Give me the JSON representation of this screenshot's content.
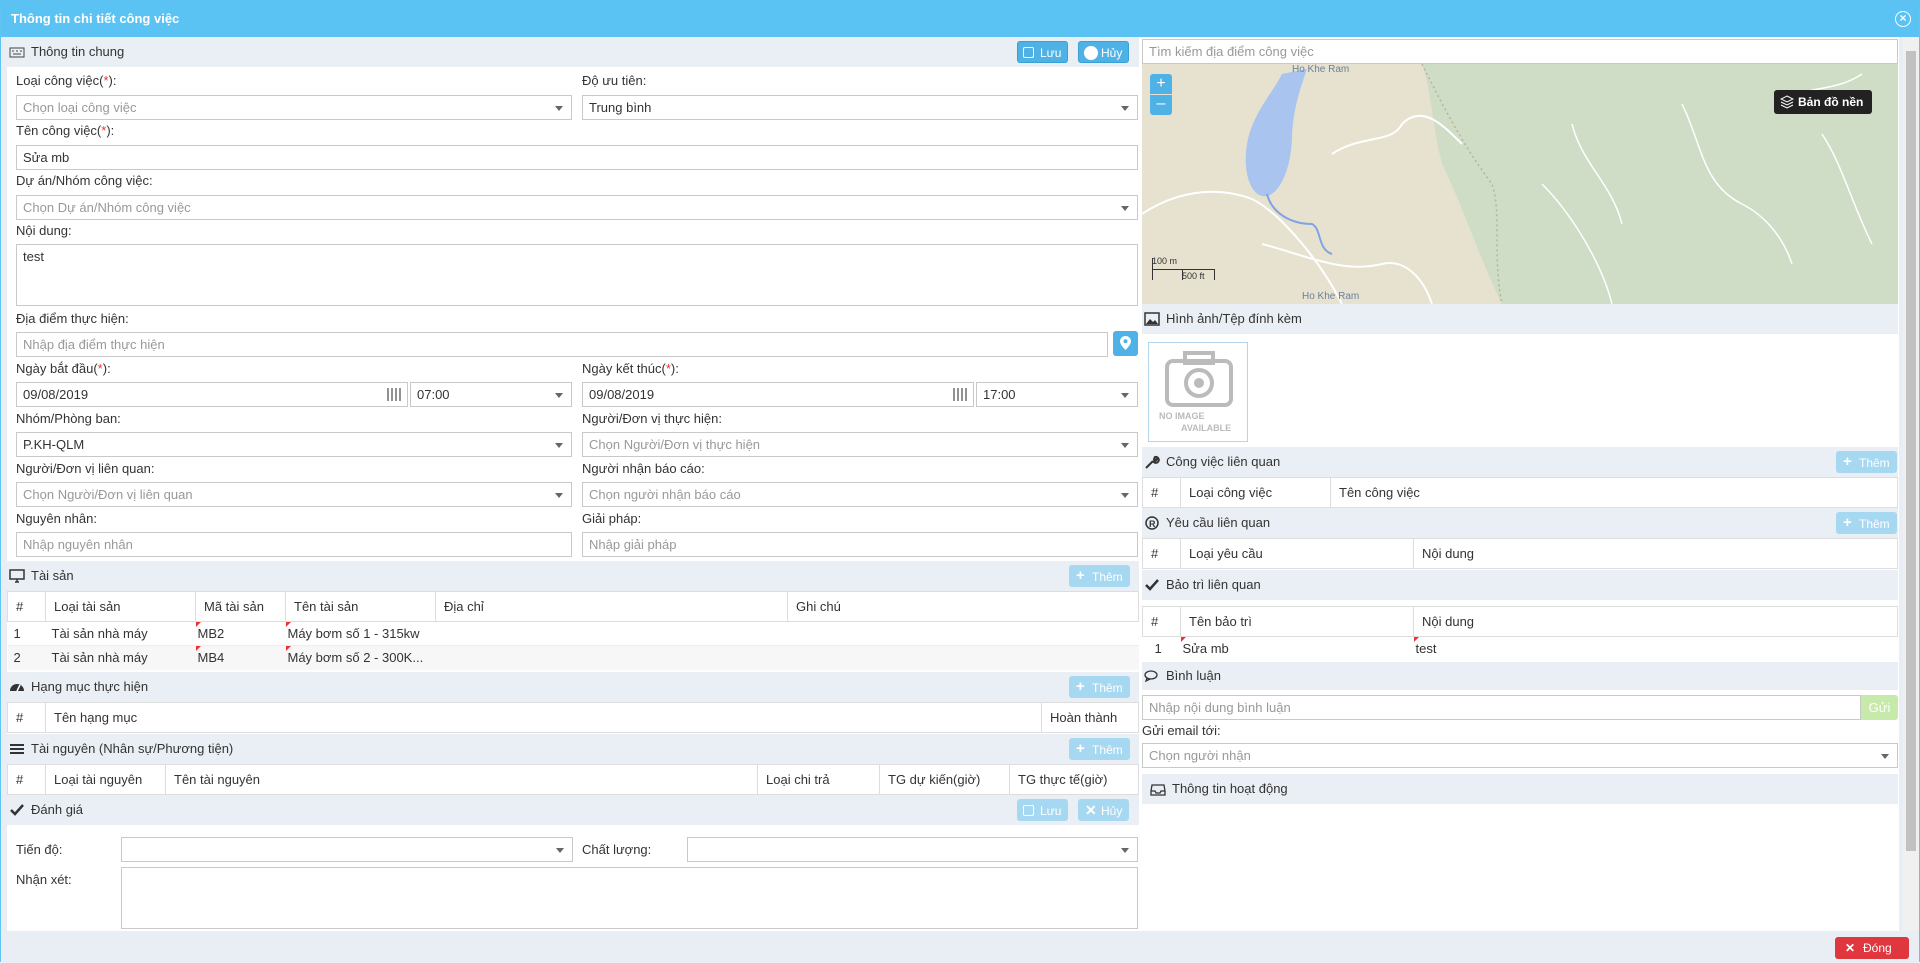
{
  "dialog": {
    "title": "Thông tin chi tiết công việc",
    "close_label": "Đóng"
  },
  "general": {
    "title": "Thông tin chung",
    "save": "Lưu",
    "cancel": "Hủy",
    "job_type_label": "Loại công việc(",
    "job_type_req": "*",
    "job_type_end": "):",
    "job_type_placeholder": "Chọn loại công việc",
    "priority_label": "Độ ưu tiên:",
    "priority_value": "Trung bình",
    "job_name_label": "Tên công việc(",
    "job_name_value": "Sửa mb",
    "project_label": "Dự án/Nhóm công việc:",
    "project_placeholder": "Chọn Dự án/Nhóm công việc",
    "content_label": "Nội dung:",
    "content_value": "test",
    "location_label": "Địa điểm thực hiện:",
    "location_placeholder": "Nhập địa điểm thực hiện",
    "start_label": "Ngày bắt đầu(",
    "start_date": "09/08/2019",
    "start_time": "07:00",
    "end_label": "Ngày kết thúc(",
    "end_date": "09/08/2019",
    "end_time": "17:00",
    "dept_label": "Nhóm/Phòng ban:",
    "dept_value": "P.KH-QLM",
    "executor_label": "Người/Đơn vị thực hiện:",
    "executor_placeholder": "Chọn Người/Đơn vị thực hiện",
    "related_label": "Người/Đơn vị liên quan:",
    "related_placeholder": "Chọn Người/Đơn vị liên quan",
    "reporter_label": "Người nhận báo cáo:",
    "reporter_placeholder": "Chọn người nhận báo cáo",
    "cause_label": "Nguyên nhân:",
    "cause_placeholder": "Nhập nguyên nhân",
    "solution_label": "Giải pháp:",
    "solution_placeholder": "Nhập giải pháp"
  },
  "assets": {
    "title": "Tài sản",
    "add": "Thêm",
    "columns": [
      "#",
      "Loại tài sản",
      "Mã tài sản",
      "Tên tài sản",
      "Địa chỉ",
      "Ghi chú"
    ],
    "rows": [
      [
        "1",
        "Tài sản nhà máy",
        "MB2",
        "Máy bơm số 1 - 315kw",
        "",
        ""
      ],
      [
        "2",
        "Tài sản nhà máy",
        "MB4",
        "Máy bơm số 2 - 300K...",
        "",
        ""
      ]
    ]
  },
  "tasks": {
    "title": "Hạng mục thực hiện",
    "add": "Thêm",
    "columns": [
      "#",
      "Tên hạng mục",
      "Hoàn thành"
    ]
  },
  "resources": {
    "title": "Tài nguyên (Nhân sự/Phương tiện)",
    "add": "Thêm",
    "columns": [
      "#",
      "Loại tài nguyên",
      "Tên tài nguyên",
      "Loại chi trả",
      "TG dự kiến(giờ)",
      "TG thực tế(giờ)"
    ]
  },
  "evaluation": {
    "title": "Đánh giá",
    "save": "Lưu",
    "cancel": "Hủy",
    "progress_label": "Tiến độ:",
    "quality_label": "Chất lượng:",
    "comment_label": "Nhận xét:"
  },
  "map": {
    "search_placeholder": "Tìm kiếm địa điểm công việc",
    "layer_button": "Bản đồ nền",
    "zoom_in": "+",
    "zoom_out": "–",
    "scale_m": "100 m",
    "scale_ft": "500 ft",
    "place": "Ho Khe Ram"
  },
  "attachments": {
    "title": "Hình ảnh/Tệp đính kèm",
    "no_image_1": "NO IMAGE",
    "no_image_2": "AVAILABLE"
  },
  "related_jobs": {
    "title": "Công việc liên quan",
    "add": "Thêm",
    "columns": [
      "#",
      "Loại công việc",
      "Tên công việc"
    ]
  },
  "related_requests": {
    "title": "Yêu cầu liên quan",
    "add": "Thêm",
    "columns": [
      "#",
      "Loại yêu cầu",
      "Nội dung"
    ]
  },
  "maintenance": {
    "title": "Bảo trì liên quan",
    "columns": [
      "#",
      "Tên bảo trì",
      "Nội dung"
    ],
    "rows": [
      [
        "1",
        "Sửa mb",
        "test"
      ]
    ]
  },
  "comments": {
    "title": "Bình luận",
    "placeholder": "Nhập nội dung bình luận",
    "send": "Gửi",
    "email_label": "Gửi email tới:",
    "email_placeholder": "Chọn người nhận"
  },
  "activity": {
    "title": "Thông tin hoạt động"
  },
  "colors": {
    "accent": "#5ac3f4",
    "button": "#4fb2e6",
    "close": "#e0363d"
  }
}
